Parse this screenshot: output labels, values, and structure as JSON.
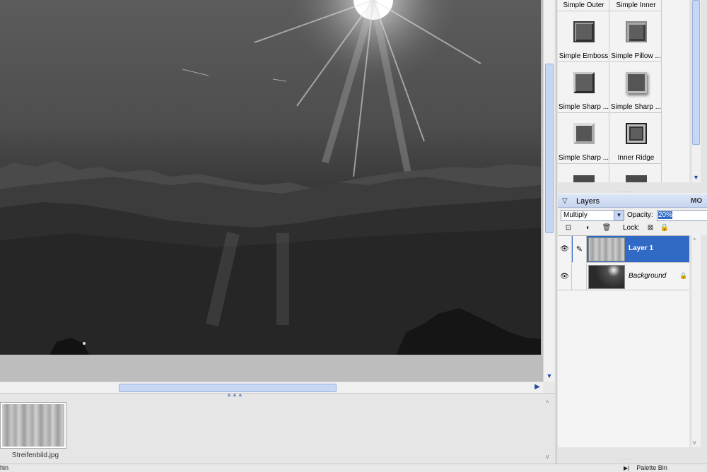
{
  "effects": {
    "tiles": [
      {
        "label": "Simple Outer",
        "swatch": "none"
      },
      {
        "label": "Simple Inner",
        "swatch": "none"
      },
      {
        "label": "Simple Emboss",
        "swatch": "emboss"
      },
      {
        "label": "Simple Pillow ...",
        "swatch": "pillow"
      },
      {
        "label": "Simple Sharp ...",
        "swatch": "sharp1"
      },
      {
        "label": "Simple Sharp ...",
        "swatch": "sharp2"
      },
      {
        "label": "Simple Sharp ...",
        "swatch": "sharp3"
      },
      {
        "label": "Inner Ridge",
        "swatch": "ridge"
      }
    ]
  },
  "layers": {
    "title": "Layers",
    "more": "MO",
    "blend_mode": "Multiply",
    "opacity_label": "Opacity:",
    "opacity_value": "20%",
    "lock_label": "Lock:",
    "items": [
      {
        "name": "Layer 1",
        "selected": true,
        "thumbnail": "stripes"
      },
      {
        "name": "Background",
        "selected": false,
        "thumbnail": "photo",
        "locked": true
      }
    ]
  },
  "photo_bin": {
    "file_name": "Streifenbild.jpg"
  },
  "status": {
    "left": "hin",
    "right": "Palette Bin"
  },
  "icons": {
    "visibility": "eye-icon",
    "brush": "brush-icon",
    "lock": "lock-icon",
    "new_layer": "new-layer-icon",
    "adjustment": "adjustment-layer-icon",
    "trash": "trash-icon"
  }
}
